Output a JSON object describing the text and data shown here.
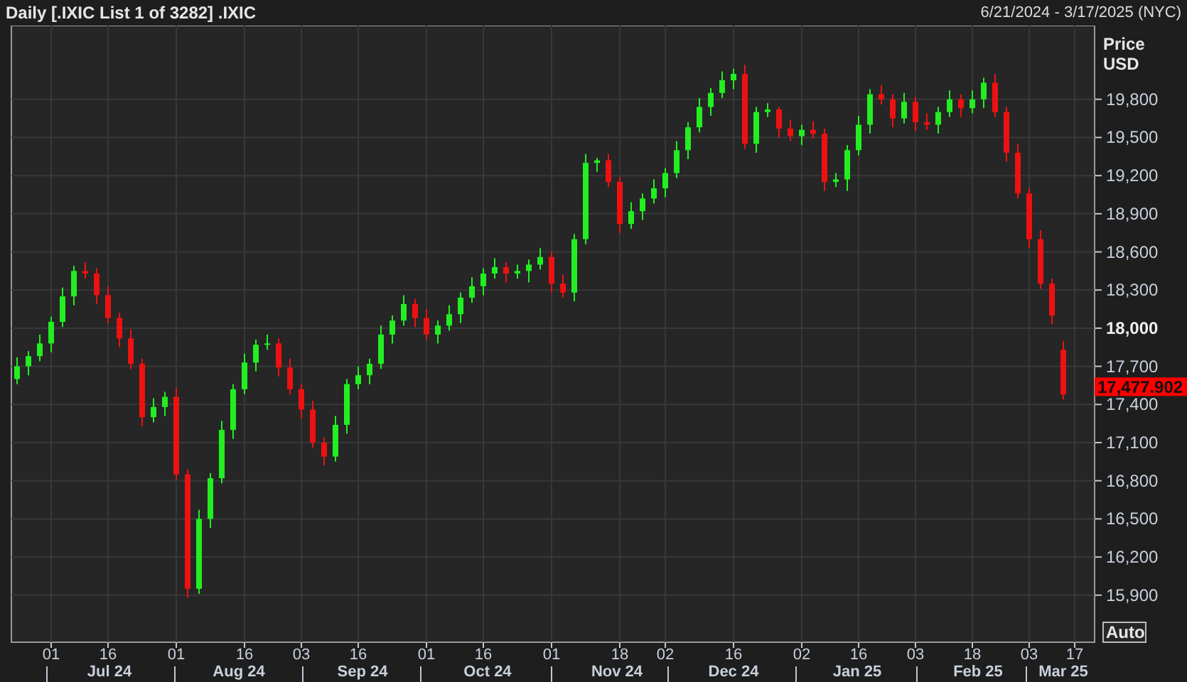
{
  "header": {
    "title": "Daily [.IXIC List 1 of 3282] .IXIC",
    "date_range": "6/21/2024 - 3/17/2025 (NYC)"
  },
  "price_axis": {
    "title": "Price",
    "unit": "USD",
    "tick_bold": [
      false,
      false,
      false,
      false,
      false,
      false,
      true,
      false,
      false,
      false,
      false,
      false,
      false,
      false
    ],
    "last_price": "17,477.902",
    "scale_button": "Auto"
  },
  "time_axis": {
    "months": [
      "Jul 24",
      "Aug 24",
      "Sep 24",
      "Oct 24",
      "Nov 24",
      "Dec 24",
      "Jan 25",
      "Feb 25",
      "Mar 25"
    ]
  },
  "chart_data": {
    "type": "candlestick",
    "grid": true,
    "ylim": [
      15530,
      20380
    ],
    "categories": [
      null,
      null,
      null,
      "01",
      null,
      null,
      null,
      null,
      "16",
      null,
      null,
      null,
      null,
      null,
      "01",
      null,
      null,
      null,
      null,
      null,
      "16",
      null,
      null,
      null,
      null,
      "03",
      null,
      null,
      null,
      null,
      "16",
      null,
      null,
      null,
      null,
      null,
      "01",
      null,
      null,
      null,
      null,
      "16",
      null,
      null,
      null,
      null,
      null,
      "01",
      null,
      null,
      null,
      null,
      null,
      "18",
      null,
      null,
      null,
      "02",
      null,
      null,
      null,
      null,
      null,
      "16",
      null,
      null,
      null,
      null,
      null,
      "02",
      null,
      null,
      null,
      null,
      "16",
      null,
      null,
      null,
      null,
      "03",
      null,
      null,
      null,
      null,
      "18",
      null,
      null,
      null,
      null,
      "03",
      null,
      null,
      null,
      "17"
    ],
    "yticks": [
      {
        "value": 19800,
        "label": "19,800"
      },
      {
        "value": 19500,
        "label": "19,500"
      },
      {
        "value": 19200,
        "label": "19,200"
      },
      {
        "value": 18900,
        "label": "18,900"
      },
      {
        "value": 18600,
        "label": "18,600"
      },
      {
        "value": 18300,
        "label": "18,300"
      },
      {
        "value": 18000,
        "label": "18,000"
      },
      {
        "value": 17700,
        "label": "17,700"
      },
      {
        "value": 17400,
        "label": "17,400"
      },
      {
        "value": 17100,
        "label": "17,100"
      },
      {
        "value": 16800,
        "label": "16,800"
      },
      {
        "value": 16500,
        "label": "16,500"
      },
      {
        "value": 16200,
        "label": "16,200"
      },
      {
        "value": 15900,
        "label": "15,900"
      }
    ],
    "ohlc": [
      [
        17600,
        17770,
        17560,
        17700
      ],
      [
        17700,
        17820,
        17630,
        17780
      ],
      [
        17780,
        17950,
        17740,
        17880
      ],
      [
        17880,
        18090,
        17810,
        18050
      ],
      [
        18050,
        18320,
        18010,
        18250
      ],
      [
        18250,
        18490,
        18180,
        18450
      ],
      [
        18450,
        18520,
        18390,
        18430
      ],
      [
        18430,
        18470,
        18190,
        18260
      ],
      [
        18260,
        18330,
        18040,
        18080
      ],
      [
        18080,
        18120,
        17850,
        17920
      ],
      [
        17920,
        17990,
        17680,
        17720
      ],
      [
        17720,
        17760,
        17230,
        17300
      ],
      [
        17300,
        17450,
        17260,
        17380
      ],
      [
        17380,
        17500,
        17310,
        17460
      ],
      [
        17460,
        17530,
        16810,
        16850
      ],
      [
        16850,
        16890,
        15880,
        15950
      ],
      [
        15950,
        16570,
        15910,
        16500
      ],
      [
        16500,
        16860,
        16430,
        16820
      ],
      [
        16820,
        17270,
        16780,
        17200
      ],
      [
        17200,
        17560,
        17130,
        17520
      ],
      [
        17520,
        17800,
        17480,
        17730
      ],
      [
        17730,
        17910,
        17660,
        17870
      ],
      [
        17870,
        17950,
        17830,
        17880
      ],
      [
        17880,
        17920,
        17620,
        17690
      ],
      [
        17690,
        17760,
        17480,
        17520
      ],
      [
        17520,
        17560,
        17290,
        17360
      ],
      [
        17360,
        17430,
        17060,
        17100
      ],
      [
        17100,
        17140,
        16920,
        16990
      ],
      [
        16990,
        17310,
        16950,
        17240
      ],
      [
        17240,
        17600,
        17170,
        17560
      ],
      [
        17560,
        17700,
        17520,
        17630
      ],
      [
        17630,
        17760,
        17560,
        17720
      ],
      [
        17720,
        18020,
        17680,
        17950
      ],
      [
        17950,
        18100,
        17880,
        18060
      ],
      [
        18060,
        18260,
        18020,
        18190
      ],
      [
        18190,
        18230,
        18010,
        18080
      ],
      [
        18080,
        18150,
        17910,
        17950
      ],
      [
        17950,
        18060,
        17880,
        18020
      ],
      [
        18020,
        18180,
        17980,
        18110
      ],
      [
        18110,
        18280,
        18040,
        18240
      ],
      [
        18240,
        18400,
        18200,
        18330
      ],
      [
        18330,
        18470,
        18260,
        18430
      ],
      [
        18430,
        18550,
        18390,
        18480
      ],
      [
        18480,
        18520,
        18360,
        18430
      ],
      [
        18430,
        18500,
        18390,
        18450
      ],
      [
        18450,
        18540,
        18360,
        18500
      ],
      [
        18500,
        18630,
        18460,
        18560
      ],
      [
        18560,
        18600,
        18280,
        18350
      ],
      [
        18350,
        18420,
        18240,
        18280
      ],
      [
        18280,
        18740,
        18210,
        18700
      ],
      [
        18700,
        19370,
        18660,
        19300
      ],
      [
        19300,
        19340,
        19230,
        19320
      ],
      [
        19320,
        19370,
        19110,
        19150
      ],
      [
        19150,
        19190,
        18750,
        18820
      ],
      [
        18820,
        18990,
        18780,
        18920
      ],
      [
        18920,
        19060,
        18850,
        19020
      ],
      [
        19020,
        19170,
        18980,
        19100
      ],
      [
        19100,
        19260,
        19030,
        19220
      ],
      [
        19220,
        19470,
        19180,
        19400
      ],
      [
        19400,
        19620,
        19330,
        19580
      ],
      [
        19580,
        19810,
        19540,
        19740
      ],
      [
        19740,
        19890,
        19670,
        19850
      ],
      [
        19850,
        20020,
        19810,
        19950
      ],
      [
        19950,
        20040,
        19880,
        20000
      ],
      [
        20000,
        20070,
        19410,
        19450
      ],
      [
        19450,
        19740,
        19380,
        19700
      ],
      [
        19700,
        19770,
        19660,
        19720
      ],
      [
        19720,
        19740,
        19500,
        19570
      ],
      [
        19570,
        19640,
        19470,
        19510
      ],
      [
        19510,
        19600,
        19440,
        19560
      ],
      [
        19560,
        19630,
        19490,
        19530
      ],
      [
        19530,
        19570,
        19080,
        19150
      ],
      [
        19150,
        19220,
        19110,
        19170
      ],
      [
        19170,
        19440,
        19080,
        19400
      ],
      [
        19400,
        19670,
        19360,
        19600
      ],
      [
        19600,
        19880,
        19530,
        19840
      ],
      [
        19840,
        19910,
        19760,
        19800
      ],
      [
        19800,
        19840,
        19580,
        19650
      ],
      [
        19650,
        19850,
        19610,
        19780
      ],
      [
        19780,
        19820,
        19550,
        19620
      ],
      [
        19620,
        19690,
        19560,
        19600
      ],
      [
        19600,
        19740,
        19530,
        19700
      ],
      [
        19700,
        19870,
        19660,
        19800
      ],
      [
        19800,
        19840,
        19660,
        19730
      ],
      [
        19730,
        19870,
        19690,
        19800
      ],
      [
        19800,
        19970,
        19730,
        19930
      ],
      [
        19930,
        20000,
        19660,
        19700
      ],
      [
        19700,
        19740,
        19310,
        19380
      ],
      [
        19380,
        19450,
        19020,
        19060
      ],
      [
        19060,
        19100,
        18630,
        18700
      ],
      [
        18700,
        18770,
        18310,
        18350
      ],
      [
        18350,
        18390,
        18030,
        18100
      ],
      [
        17830,
        17900,
        17440,
        17477.902
      ],
      null
    ]
  }
}
